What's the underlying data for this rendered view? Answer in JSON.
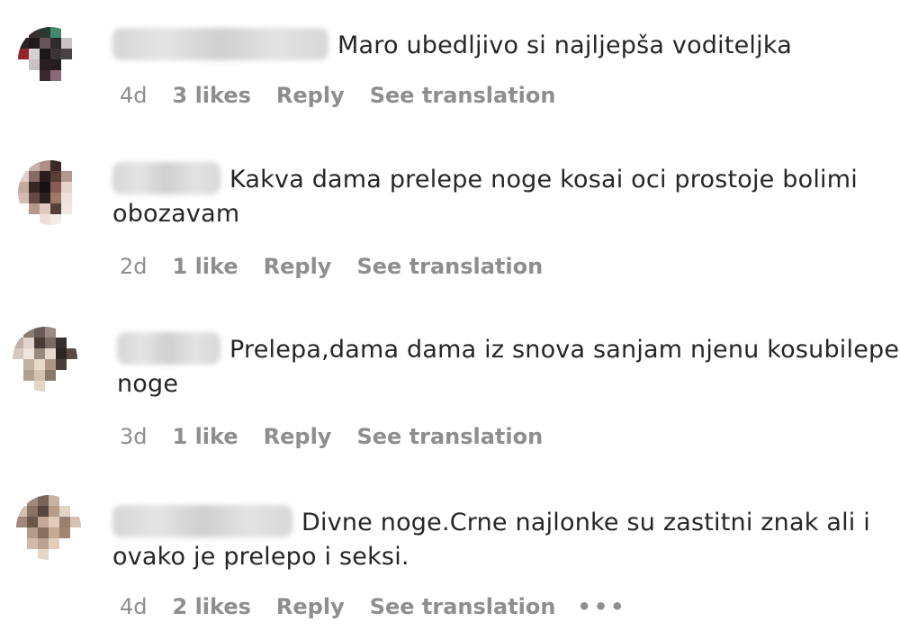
{
  "comments": [
    {
      "text": "Maro ubedljivo si najljepša voditeljka",
      "time": "4d",
      "likes": "3 likes",
      "reply": "Reply",
      "translate": "See translation",
      "avatar_colors": [
        "#ffffff",
        "#3a2e30",
        "#2c3a34",
        "#3f8a6d",
        "#ffffff",
        "#ffffff",
        "#2a2426",
        "#1e1a1c",
        "#6a5559",
        "#2f2a2c",
        "#c9c4c6",
        "#ffffff",
        "#9c1f2d",
        "#d8d0d2",
        "#1c1718",
        "#3c3537",
        "#4a4446",
        "#ffffff",
        "#ffffff",
        "#c8c0c4",
        "#2a1e22",
        "#241e20",
        "#ffffff",
        "#ffffff",
        "#ffffff",
        "#ffffff",
        "#3a2830",
        "#8a6a76",
        "#ffffff",
        "#ffffff",
        "#ffffff",
        "#ffffff",
        "#ffffff",
        "#ffffff",
        "#ffffff",
        "#ffffff"
      ]
    },
    {
      "text": "Kakva dama prelepe noge kosai oci prostoje bolimi obozavam",
      "time": "2d",
      "likes": "1 like",
      "reply": "Reply",
      "translate": "See translation",
      "avatar_colors": [
        "#ffffff",
        "#c9b1a6",
        "#b08c84",
        "#3a2a26",
        "#ffffff",
        "#ffffff",
        "#e3d0c8",
        "#8a6a60",
        "#2a1e1c",
        "#5a3d36",
        "#b59a8e",
        "#ffffff",
        "#c6a89c",
        "#3a2622",
        "#1a1212",
        "#8c5a52",
        "#e8d4cc",
        "#ffffff",
        "#d4bcb2",
        "#6a4a42",
        "#2e201e",
        "#a07868",
        "#f0e2da",
        "#ffffff",
        "#ffffff",
        "#b8988a",
        "#e0cabe",
        "#584038",
        "#f2e6e0",
        "#ffffff",
        "#ffffff",
        "#ffffff",
        "#efe0d8",
        "#f6ece6",
        "#ffffff",
        "#ffffff"
      ]
    },
    {
      "text": "Prelepa,dama dama iz snova sanjam njenu kosubilepe noge",
      "time": "3d",
      "likes": "1 like",
      "reply": "Reply",
      "translate": "See translation",
      "avatar_colors": [
        "#ffffff",
        "#8a7c74",
        "#6a5c56",
        "#9c8a80",
        "#ffffff",
        "#ffffff",
        "#c0b0a6",
        "#e2d4ca",
        "#4a3c36",
        "#7a6a62",
        "#3a302c",
        "#ffffff",
        "#d8c8bc",
        "#f0e4da",
        "#9a887c",
        "#e8d8cc",
        "#2e2622",
        "#5a4a44",
        "#ffffff",
        "#c4b09e",
        "#ead8c6",
        "#b09682",
        "#4c3e38",
        "#ffffff",
        "#ffffff",
        "#b4a08c",
        "#d6c2ae",
        "#8c7866",
        "#ffffff",
        "#ffffff",
        "#ffffff",
        "#ffffff",
        "#e6d6c4",
        "#ffffff",
        "#ffffff",
        "#ffffff"
      ]
    },
    {
      "text": "Divne noge.Crne najlonke su zastitni znak ali i ovako je prelepo i seksi.",
      "time": "4d",
      "likes": "2 likes",
      "reply": "Reply",
      "translate": "See translation",
      "more": "•••",
      "avatar_colors": [
        "#ffffff",
        "#a08a7c",
        "#7a6458",
        "#c8b4a4",
        "#ffffff",
        "#ffffff",
        "#d6c0ae",
        "#8c7262",
        "#5a463a",
        "#b89c88",
        "#e6d4c4",
        "#ffffff",
        "#a4887a",
        "#6e5648",
        "#c4a894",
        "#e2cab6",
        "#9a7e6c",
        "#d8c2b0",
        "#ffffff",
        "#b69a86",
        "#8a6e5c",
        "#caa890",
        "#a48470",
        "#ffffff",
        "#ffffff",
        "#d2baa6",
        "#bca08c",
        "#e4ceba",
        "#ffffff",
        "#ffffff",
        "#ffffff",
        "#ffffff",
        "#e8d6c6",
        "#ffffff",
        "#ffffff",
        "#ffffff"
      ]
    }
  ]
}
